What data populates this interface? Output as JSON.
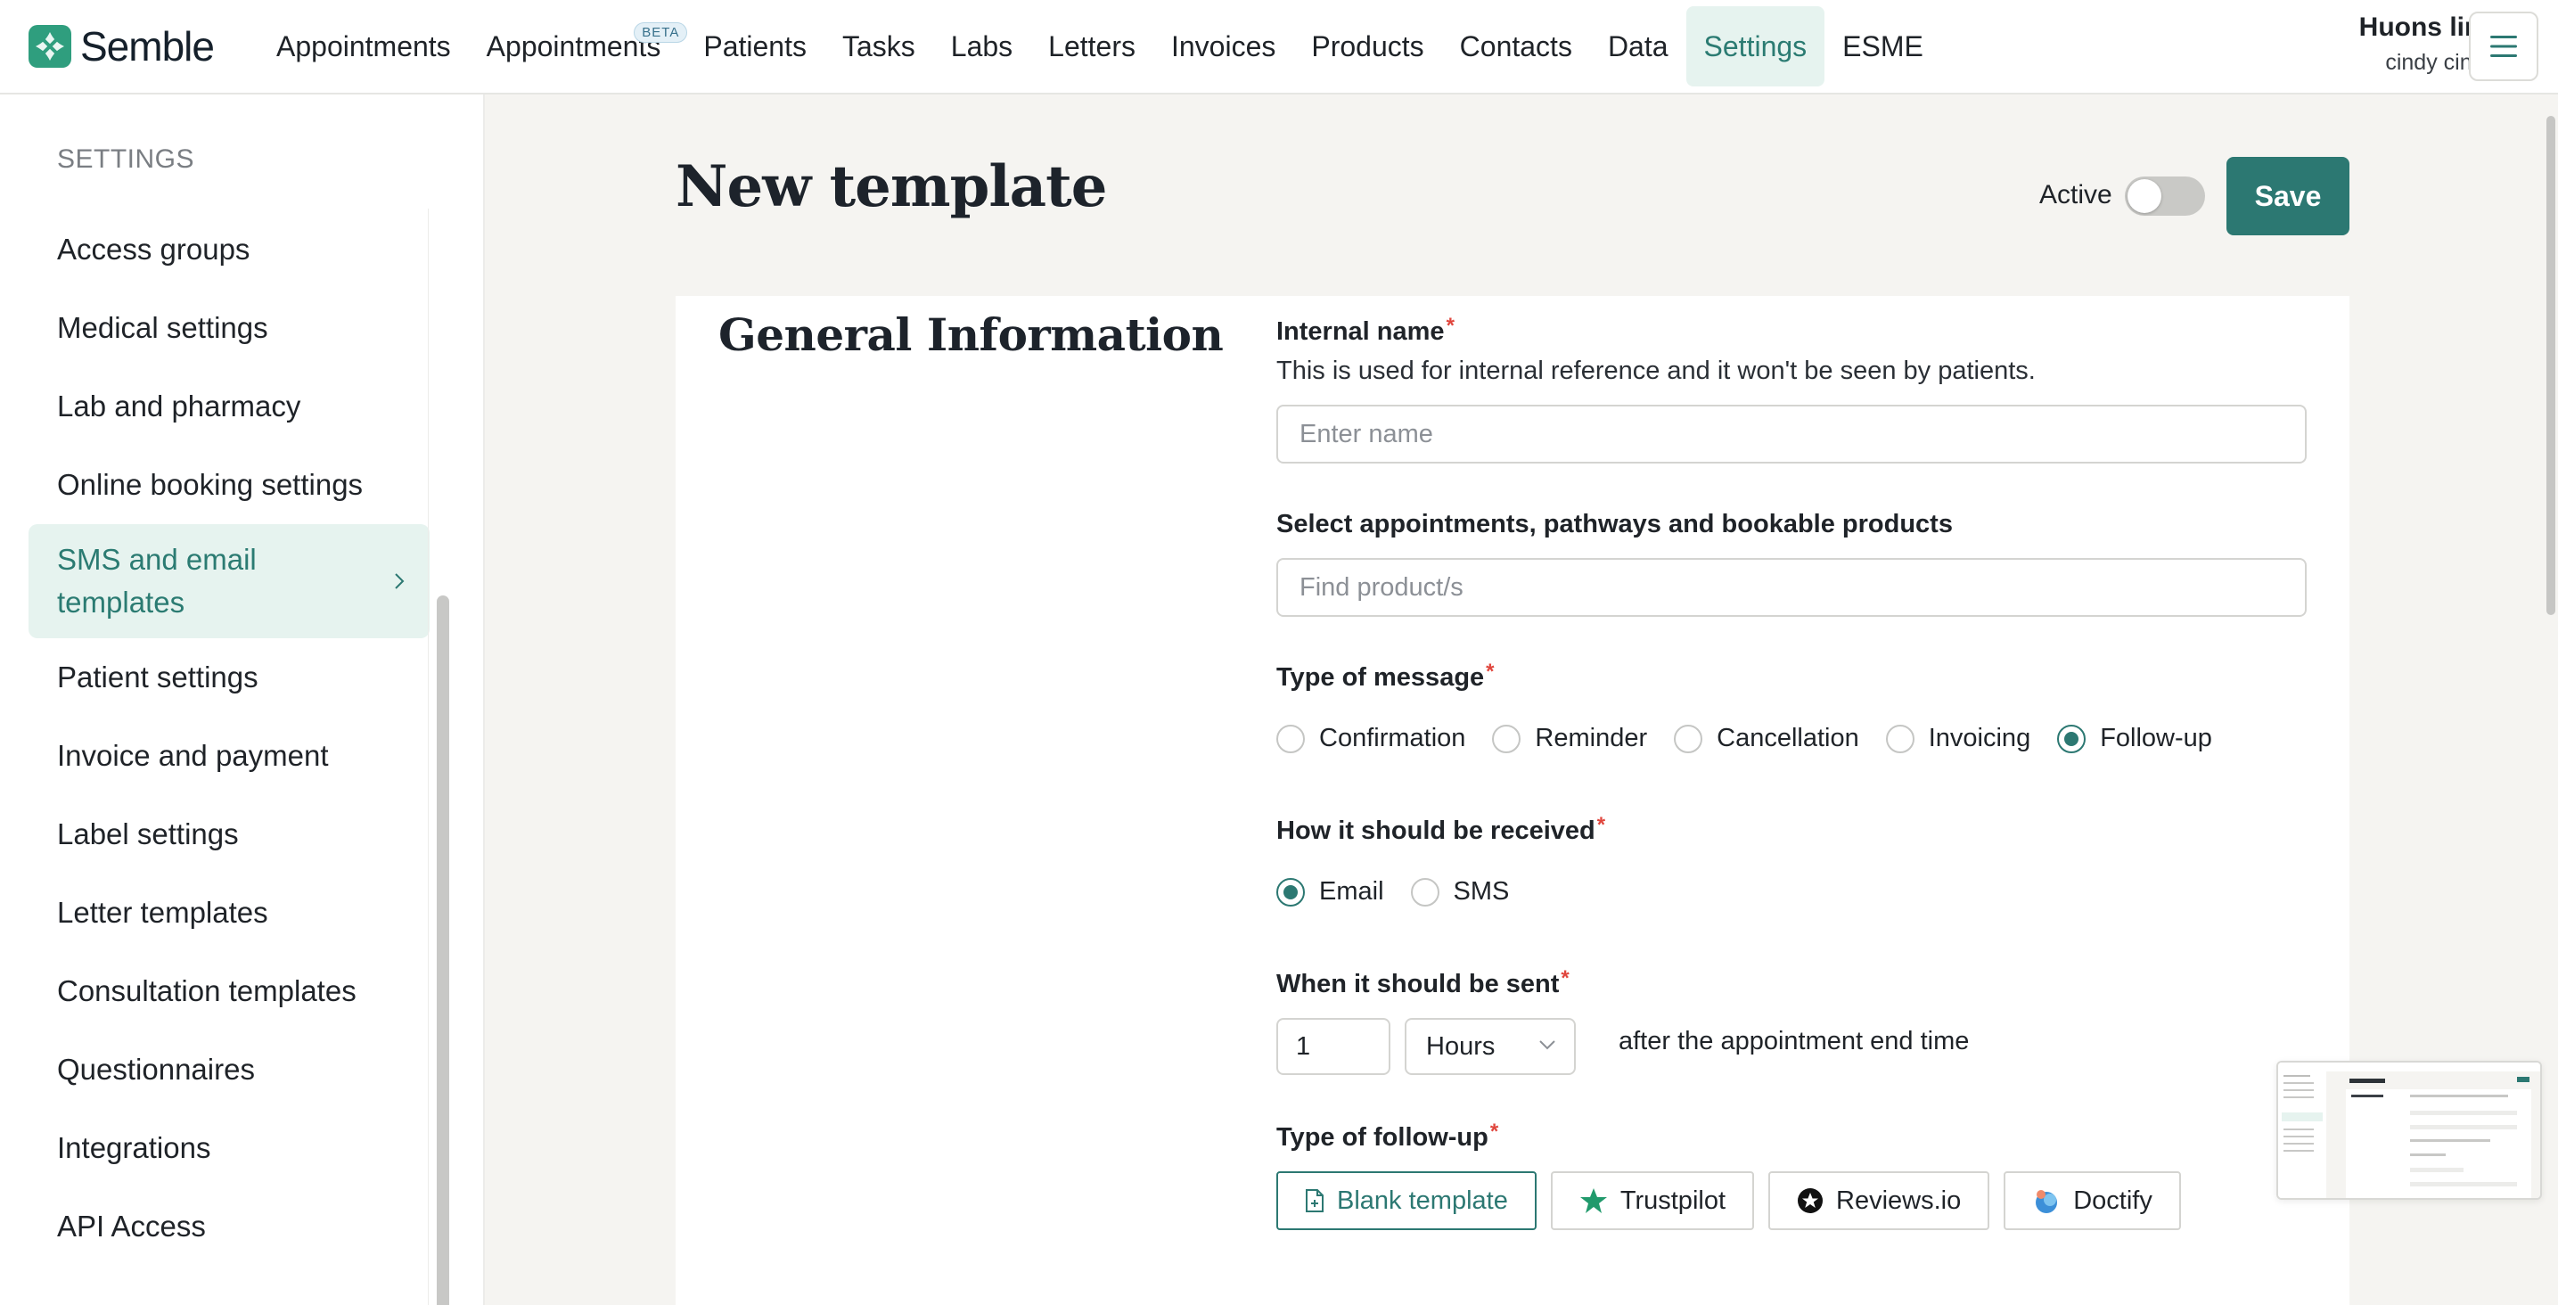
{
  "app": {
    "logo_text": "Semble",
    "brand_color": "#2f9e7e",
    "accent_color": "#2c7872"
  },
  "nav": {
    "items": [
      {
        "label": "Appointments"
      },
      {
        "label": "Appointments",
        "badge": "BETA"
      },
      {
        "label": "Patients"
      },
      {
        "label": "Tasks"
      },
      {
        "label": "Labs"
      },
      {
        "label": "Letters"
      },
      {
        "label": "Invoices"
      },
      {
        "label": "Products"
      },
      {
        "label": "Contacts"
      },
      {
        "label": "Data"
      },
      {
        "label": "Settings",
        "active": true
      },
      {
        "label": "ESME"
      }
    ],
    "menu_icon": "hamburger-menu-icon"
  },
  "user": {
    "org": "Huons link",
    "name": "cindy cindy"
  },
  "sidebar": {
    "heading": "SETTINGS",
    "items": [
      {
        "label": "Access groups"
      },
      {
        "label": "Medical settings"
      },
      {
        "label": "Lab and pharmacy"
      },
      {
        "label": "Online booking settings"
      },
      {
        "label": "SMS and email templates",
        "active": true
      },
      {
        "label": "Patient settings"
      },
      {
        "label": "Invoice and payment"
      },
      {
        "label": "Label settings"
      },
      {
        "label": "Letter templates"
      },
      {
        "label": "Consultation templates"
      },
      {
        "label": "Questionnaires"
      },
      {
        "label": "Integrations"
      },
      {
        "label": "API Access"
      }
    ]
  },
  "page": {
    "title": "New template",
    "active_label": "Active",
    "active_on": false,
    "save_label": "Save"
  },
  "form": {
    "section_title": "General Information",
    "internal_name": {
      "label": "Internal name",
      "help": "This is used for internal reference and it won't be seen by patients.",
      "value": "",
      "placeholder": "Enter name"
    },
    "products": {
      "label": "Select appointments, pathways and bookable products",
      "placeholder": "Find product/s"
    },
    "message_type": {
      "label": "Type of message",
      "options": [
        "Confirmation",
        "Reminder",
        "Cancellation",
        "Invoicing",
        "Follow-up"
      ],
      "selected": "Follow-up"
    },
    "received": {
      "label": "How it should be received",
      "options": [
        "Email",
        "SMS"
      ],
      "selected": "Email"
    },
    "when_sent": {
      "label": "When it should be sent",
      "amount": "1",
      "unit": "Hours",
      "suffix": "after the appointment end time"
    },
    "follow_up": {
      "label": "Type of follow-up",
      "options": [
        {
          "label": "Blank template",
          "icon": "document-icon",
          "selected": true
        },
        {
          "label": "Trustpilot",
          "icon": "trustpilot-star-icon"
        },
        {
          "label": "Reviews.io",
          "icon": "reviews-io-star-icon"
        },
        {
          "label": "Doctify",
          "icon": "doctify-icon"
        }
      ]
    }
  }
}
